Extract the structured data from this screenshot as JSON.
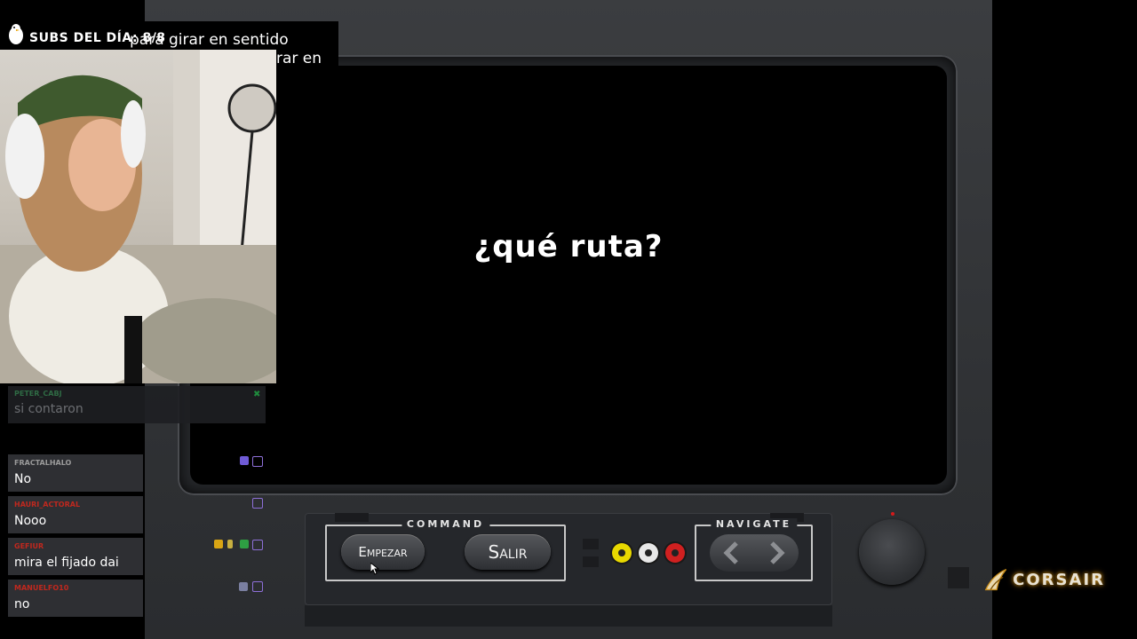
{
  "overlay": {
    "subgoal_label": "SUBS DEL DÍA: 8/8",
    "ticker_line1": "para girar en sentido",
    "ticker_line2": "rar en"
  },
  "screen": {
    "title": "¿qué ruta?"
  },
  "controls": {
    "command_title": "COMMAND",
    "navigate_title": "NAVIGATE",
    "start_label": "Empezar",
    "exit_label": "Salir",
    "rca_colors": [
      "#e8d800",
      "#e8e8e8",
      "#d02020"
    ]
  },
  "chat": {
    "faded": {
      "user": "PETER_CABJ",
      "text": "si contaron"
    },
    "messages": [
      {
        "user": "FRACTALHALO",
        "text": "No",
        "user_color": "#9a9a9a"
      },
      {
        "user": "HAURI_ACTORAL",
        "text": "Nooo",
        "user_color": "#c0281e"
      },
      {
        "user": "GEFIUR",
        "text": "mira el fijado dai",
        "user_color": "#c0281e"
      },
      {
        "user": "MANUELFO10",
        "text": "no",
        "user_color": "#c0281e"
      }
    ]
  },
  "brand": {
    "sponsor": "CORSAIR"
  },
  "colors": {
    "accent_chat_icon": "#8d6fd8",
    "led": "#d41a1a",
    "sponsor_glow": "#c98d1a"
  }
}
